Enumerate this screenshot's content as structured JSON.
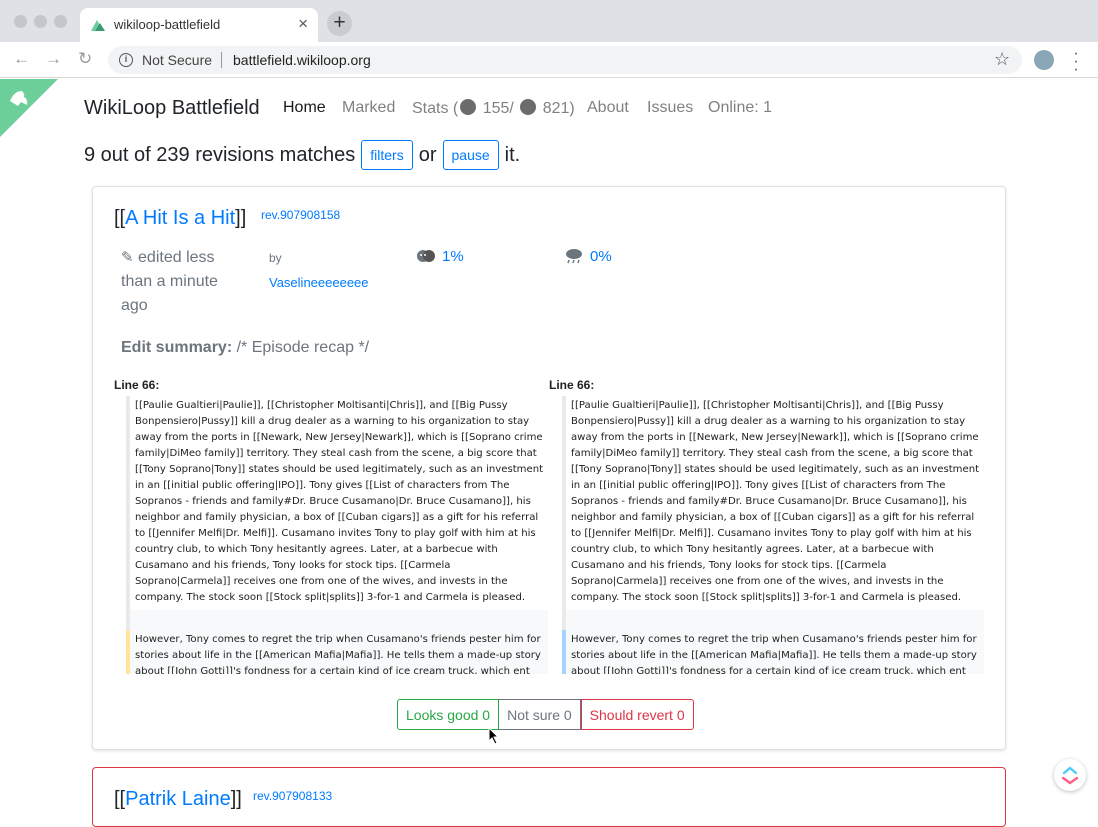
{
  "browser": {
    "tab_title": "wikiloop-battlefield",
    "tab_close": "×",
    "new_tab": "+",
    "security_label": "Not Secure",
    "url": "battlefield.wikiloop.org"
  },
  "navbar": {
    "brand": "WikiLoop Battlefield",
    "items": [
      {
        "label": "Home",
        "active": true
      },
      {
        "label": "Marked"
      },
      {
        "label": "Stats ("
      },
      {
        "label": "155/"
      },
      {
        "label": "821)"
      },
      {
        "label": "About"
      },
      {
        "label": "Issues"
      },
      {
        "label": "Online: 1"
      }
    ]
  },
  "heading": {
    "text": "9 out of 239 revisions matches",
    "filters_label": "filters",
    "or_text": "or",
    "pause_label": "pause",
    "end_text": "it."
  },
  "card1": {
    "title_prefix": "[[",
    "title_link": "A Hit Is a Hit",
    "title_suffix": "]]",
    "rev": "rev.907908158",
    "edited": "edited less than a minute ago",
    "by": "by",
    "user": "Vaselineeeeeeee",
    "score_ores_bad": "1%",
    "score_ores_damaging": "0%",
    "summary_label": "Edit summary:",
    "summary_text": "/* Episode recap */",
    "diff_left_label": "Line 66:",
    "diff_right_label": "Line 66:",
    "diff_left_para1": "[[Paulie Gualtieri|Paulie]], [[Christopher Moltisanti|Chris]], and [[Big Pussy Bonpensiero|Pussy]] kill a drug dealer as a warning to his organization to stay away from the ports in [[Newark, New Jersey|Newark]], which is [[Soprano crime family|DiMeo family]] territory. They steal cash from the scene, a big score that [[Tony Soprano|Tony]] states should be used legitimately, such as an investment in an [[initial public offering|IPO]]. Tony gives [[List of characters from The Sopranos - friends and family#Dr. Bruce Cusamano|Dr. Bruce Cusamano]], his neighbor and family physician, a box of [[Cuban cigars]] as a gift for his referral to [[Jennifer Melfi|Dr. Melfi]]. Cusamano invites Tony to play golf with him at his country club, to which Tony hesitantly agrees. Later, at a barbecue with Cusamano and his friends, Tony looks for stock tips. [[Carmela Soprano|Carmela]] receives one from one of the wives, and invests in the company. The stock soon [[Stock split|splits]] 3-for-1 and Carmela is pleased.",
    "diff_left_para2": "However, Tony comes to regret the trip when Cusamano's friends pester him for stories about life in the [[American Mafia|Mafia]]. He tells them a made-up story about [[John Gotti]]'s fondness for a certain kind of ice cream truck, which ent",
    "diff_right_para1": "[[Paulie Gualtieri|Paulie]], [[Christopher Moltisanti|Chris]], and [[Big Pussy Bonpensiero|Pussy]] kill a drug dealer as a warning to his organization to stay away from the ports in [[Newark, New Jersey|Newark]], which is [[Soprano crime family|DiMeo family]] territory. They steal cash from the scene, a big score that [[Tony Soprano|Tony]] states should be used legitimately, such as an investment in an [[initial public offering|IPO]]. Tony gives [[List of characters from The Sopranos - friends and family#Dr. Bruce Cusamano|Dr. Bruce Cusamano]], his neighbor and family physician, a box of [[Cuban cigars]] as a gift for his referral to [[Jennifer Melfi|Dr. Melfi]]. Cusamano invites Tony to play golf with him at his country club, to which Tony hesitantly agrees. Later, at a barbecue with Cusamano and his friends, Tony looks for stock tips. [[Carmela Soprano|Carmela]] receives one from one of the wives, and invests in the company. The stock soon [[Stock split|splits]] 3-for-1 and Carmela is pleased.",
    "diff_right_para2": "However, Tony comes to regret the trip when Cusamano's friends pester him for stories about life in the [[American Mafia|Mafia]]. He tells them a made-up story about [[John Gotti]]'s fondness for a certain kind of ice cream truck, which ent",
    "btn_good": "Looks good 0",
    "btn_unsure": "Not sure 0",
    "btn_revert": "Should revert 0"
  },
  "card2": {
    "title_prefix": "[[",
    "title_link": "Patrik Laine",
    "title_suffix": "]]",
    "rev": "rev.907908133"
  },
  "colors": {
    "accent": "#007bff",
    "good": "#28a745",
    "unsure": "#6c757d",
    "revert": "#dc3545",
    "badge": "#6ccf9a"
  }
}
